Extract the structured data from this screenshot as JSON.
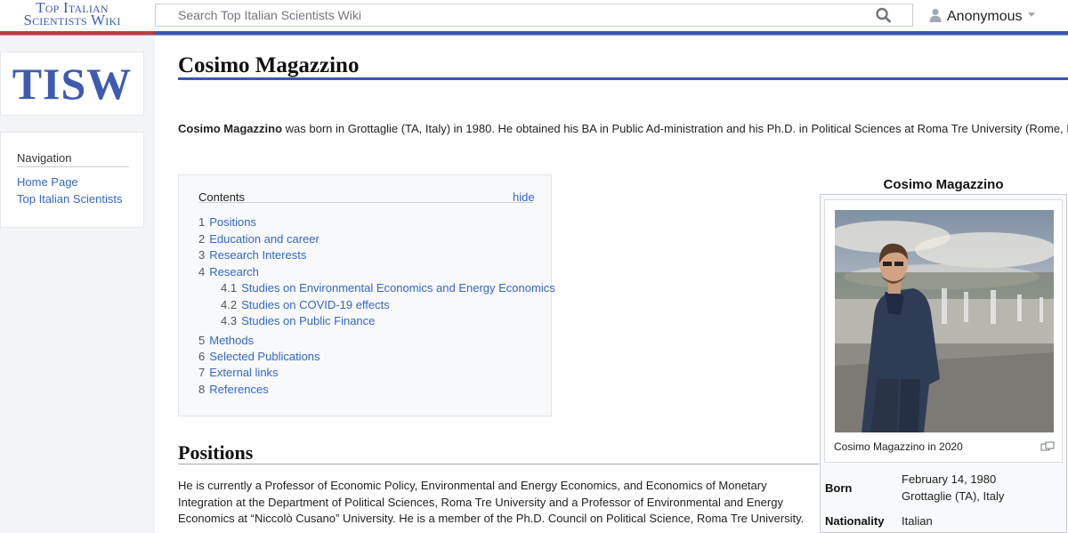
{
  "header": {
    "logo_line1": "Top Italian",
    "logo_line2": "Scientists Wiki",
    "search_placeholder": "Search Top Italian Scientists Wiki",
    "user_label": "Anonymous"
  },
  "sidebar": {
    "logo": "TISW",
    "nav_heading": "Navigation",
    "links": [
      "Home Page",
      "Top Italian Scientists"
    ]
  },
  "page": {
    "title": "Cosimo Magazzino",
    "intro_name": "Cosimo Magazzino",
    "intro_rest": " was born in Grottaglie (TA, Italy) in 1980. He obtained his BA in Public Ad-ministration and his Ph.D. in Political Sciences at Roma Tre University (Rome, Italy)."
  },
  "toc": {
    "title": "Contents",
    "hide": "hide",
    "items": [
      {
        "num": "1",
        "label": "Positions"
      },
      {
        "num": "2",
        "label": "Education and career"
      },
      {
        "num": "3",
        "label": "Research Interests"
      },
      {
        "num": "4",
        "label": "Research"
      },
      {
        "num": "4.1",
        "label": "Studies on Environmental Economics and Energy Economics"
      },
      {
        "num": "4.2",
        "label": "Studies on COVID-19 effects"
      },
      {
        "num": "4.3",
        "label": "Studies on Public Finance"
      },
      {
        "num": "5",
        "label": "Methods"
      },
      {
        "num": "6",
        "label": "Selected Publications"
      },
      {
        "num": "7",
        "label": "External links"
      },
      {
        "num": "8",
        "label": "References"
      }
    ]
  },
  "positions": {
    "heading": "Positions",
    "text": "He is currently a Professor of Economic Policy, Environmental and Energy Economics, and Economics of Monetary Integration at the Department of Political Sciences, Roma Tre University and a Professor of Environmental and Energy Economics at “Niccolò Cusano” University. He is a member of the Ph.D. Council on Political Science, Roma Tre University."
  },
  "infobox": {
    "title": "Cosimo Magazzino",
    "caption": "Cosimo Magazzino in 2020",
    "born_label": "Born",
    "born_date": "February 14, 1980",
    "born_place": "Grottaglie (TA), Italy",
    "nationality_label": "Nationality",
    "nationality": "Italian"
  }
}
